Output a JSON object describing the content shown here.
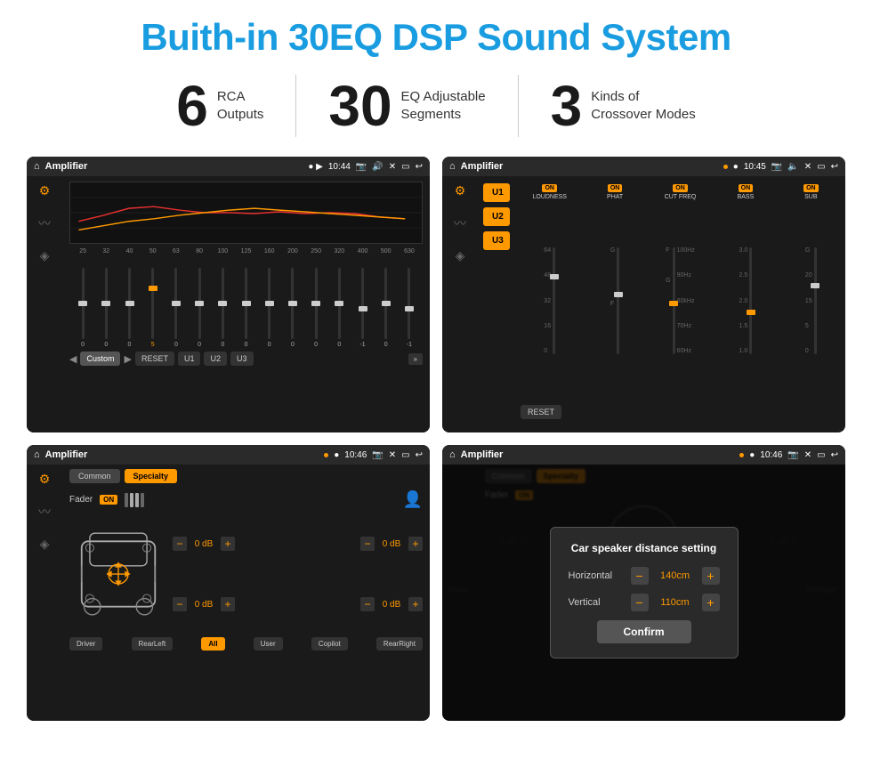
{
  "header": {
    "title": "Buith-in 30EQ DSP Sound System"
  },
  "stats": [
    {
      "number": "6",
      "label_line1": "RCA",
      "label_line2": "Outputs"
    },
    {
      "number": "30",
      "label_line1": "EQ Adjustable",
      "label_line2": "Segments"
    },
    {
      "number": "3",
      "label_line1": "Kinds of",
      "label_line2": "Crossover Modes"
    }
  ],
  "screens": [
    {
      "id": "screen1",
      "topbar": {
        "title": "Amplifier",
        "time": "10:44"
      },
      "eq_freqs": [
        "25",
        "32",
        "40",
        "50",
        "63",
        "80",
        "100",
        "125",
        "160",
        "200",
        "250",
        "320",
        "400",
        "500",
        "630"
      ],
      "eq_values": [
        "0",
        "0",
        "0",
        "5",
        "0",
        "0",
        "0",
        "0",
        "0",
        "0",
        "0",
        "0",
        "-1",
        "0",
        "-1"
      ],
      "eq_preset": "Custom",
      "bottom_buttons": [
        "◀",
        "Custom",
        "▶",
        "RESET",
        "U1",
        "U2",
        "U3"
      ]
    },
    {
      "id": "screen2",
      "topbar": {
        "title": "Amplifier",
        "time": "10:45"
      },
      "u_buttons": [
        "U1",
        "U2",
        "U3"
      ],
      "channels": [
        {
          "name": "LOUDNESS",
          "on": true
        },
        {
          "name": "PHAT",
          "on": true
        },
        {
          "name": "CUT FREQ",
          "on": true
        },
        {
          "name": "BASS",
          "on": true
        },
        {
          "name": "SUB",
          "on": true
        }
      ],
      "reset_label": "RESET"
    },
    {
      "id": "screen3",
      "topbar": {
        "title": "Amplifier",
        "time": "10:46"
      },
      "tabs": [
        "Common",
        "Specialty"
      ],
      "fader_label": "Fader",
      "fader_on": "ON",
      "db_controls": [
        {
          "position": "top-left",
          "value": "0 dB"
        },
        {
          "position": "top-right",
          "value": "0 dB"
        },
        {
          "position": "bottom-left",
          "value": "0 dB"
        },
        {
          "position": "bottom-right",
          "value": "0 dB"
        }
      ],
      "bottom_buttons": [
        "Driver",
        "RearLeft",
        "All",
        "User",
        "Copilot",
        "RearRight"
      ]
    },
    {
      "id": "screen4",
      "topbar": {
        "title": "Amplifier",
        "time": "10:46"
      },
      "tabs": [
        "Common",
        "Specialty"
      ],
      "dialog": {
        "title": "Car speaker distance setting",
        "horizontal_label": "Horizontal",
        "horizontal_value": "140cm",
        "vertical_label": "Vertical",
        "vertical_value": "110cm",
        "confirm_label": "Confirm"
      },
      "bottom_buttons": [
        "Driver",
        "RearLeft",
        "All",
        "User",
        "Copilot",
        "RearRight"
      ]
    }
  ]
}
